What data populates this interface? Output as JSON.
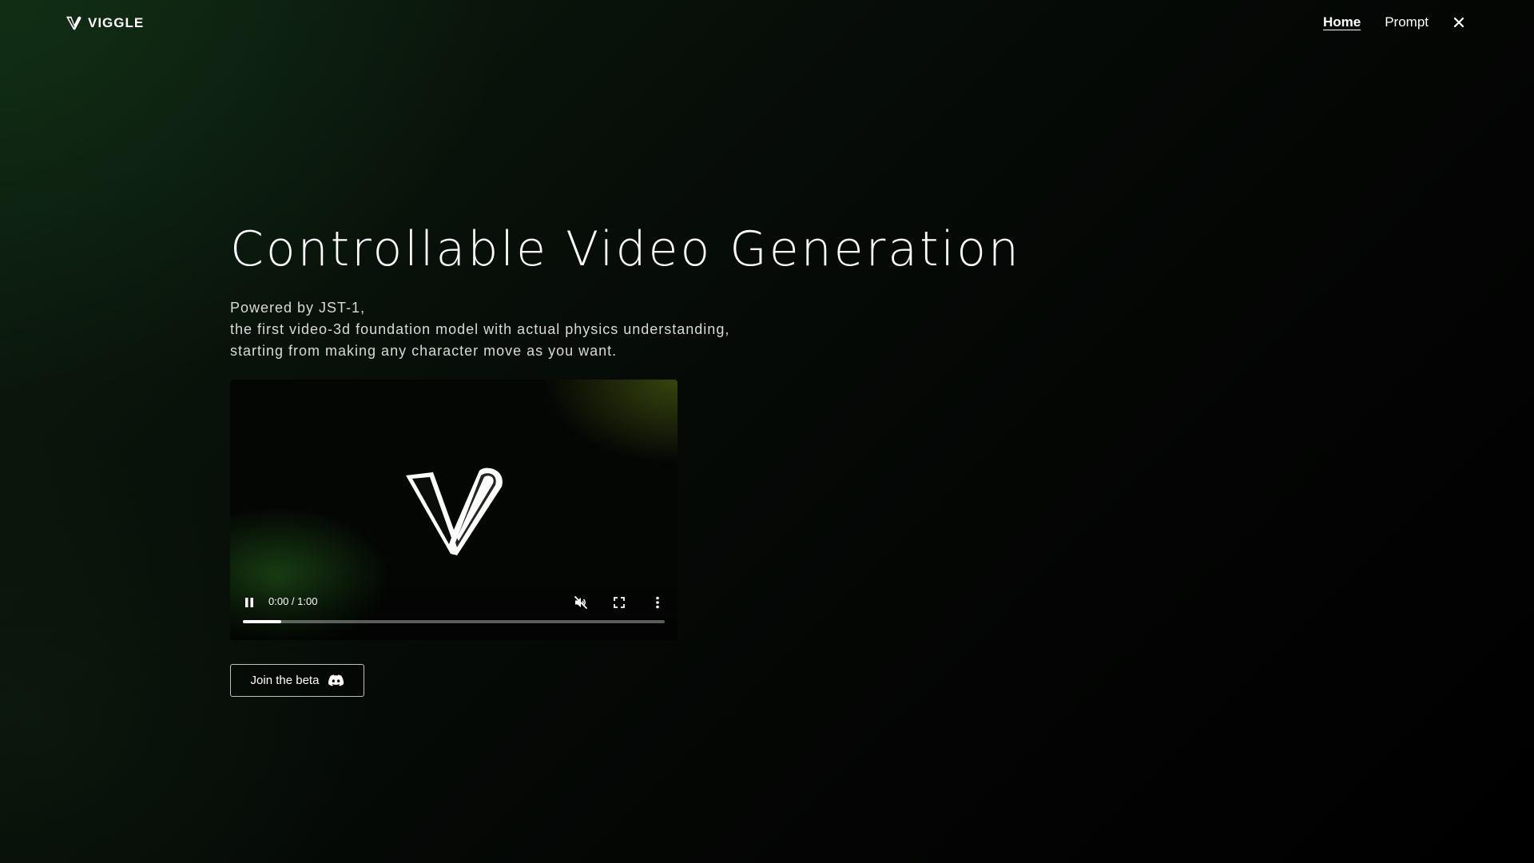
{
  "header": {
    "logo_text": "VIGGLE",
    "logo_icon": "viggle-v-icon",
    "nav": [
      {
        "label": "Home",
        "active": true
      },
      {
        "label": "Prompt",
        "active": false
      }
    ],
    "close_icon": "close-icon"
  },
  "hero": {
    "title": "Controllable Video Generation",
    "subtitle_lines": [
      "Powered by JST-1,",
      "the first video-3d foundation model with actual physics understanding,",
      "starting from making any character move as you want."
    ]
  },
  "video": {
    "time_display": "0:00 / 1:00",
    "progress": 0.09,
    "play_state": "playing",
    "muted": true,
    "icons": {
      "pause": "pause-icon",
      "mute": "volume-muted-icon",
      "fullscreen": "fullscreen-icon",
      "more": "more-vertical-icon"
    }
  },
  "cta": {
    "label": "Join the beta",
    "icon": "discord-icon"
  },
  "colors": {
    "background": "#000000",
    "accent_green": "#1f5a22",
    "text": "#ffffff"
  }
}
